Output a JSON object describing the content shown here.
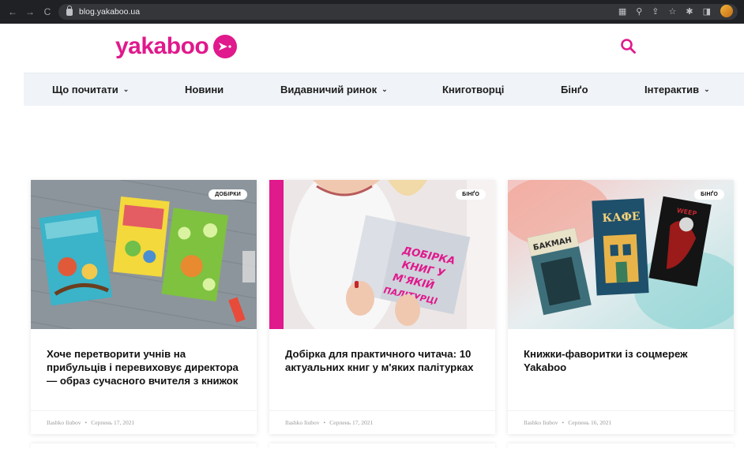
{
  "browser": {
    "url": "blog.yakaboo.ua",
    "icons": [
      "back-icon",
      "forward-icon",
      "reload-icon",
      "translate-icon",
      "zoom-icon",
      "share-icon",
      "star-icon",
      "extensions-icon",
      "sidepanel-icon",
      "profile-avatar"
    ]
  },
  "brand": {
    "name": "yakaboo",
    "color": "#e0198c"
  },
  "nav": {
    "items": [
      {
        "label": "Що почитати",
        "dropdown": true
      },
      {
        "label": "Новини",
        "dropdown": false
      },
      {
        "label": "Видавничий ринок",
        "dropdown": true
      },
      {
        "label": "Книготворці",
        "dropdown": false
      },
      {
        "label": "Бінґо",
        "dropdown": false
      },
      {
        "label": "Інтерактив",
        "dropdown": true
      }
    ]
  },
  "cards": [
    {
      "badge": "ДОБІРКИ",
      "title": "Хоче перетворити учнів на прибульців і перевиховує директора — образ сучасного вчителя з книжок",
      "author": "Ilashko Iiubov",
      "date": "Серпень 17, 2021"
    },
    {
      "badge": "БІНҐО",
      "title": "Добірка для практичного читача: 10 актуальних книг у м'яких палітурках",
      "author": "Ilashko Iiubov",
      "date": "Серпень 17, 2021",
      "image_text": "ДОБІРКА КНИГ У М'ЯКІЙ ПАЛІТУРЦІ"
    },
    {
      "badge": "БІНҐО",
      "title": "Книжки-фаворитки із соцмереж Yakaboo",
      "author": "Ilashko Iiubov",
      "date": "Серпень 16, 2021",
      "image_text": {
        "book1": "БАКМАН",
        "book2": "КАФЕ"
      }
    }
  ]
}
